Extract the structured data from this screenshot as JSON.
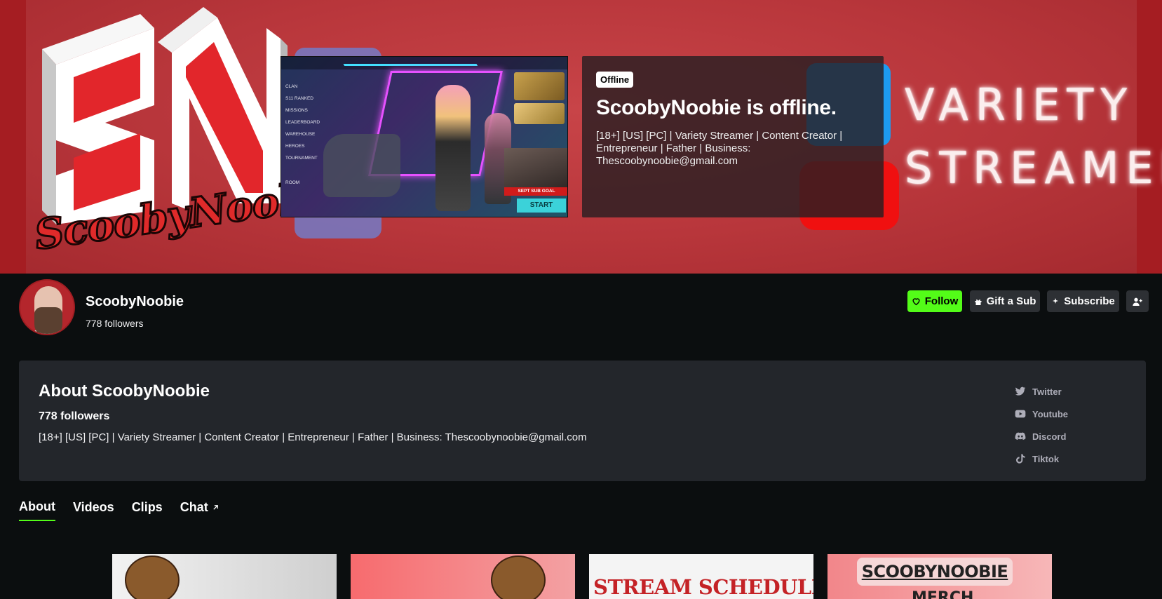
{
  "banner": {
    "logo_text": "ScoobyNoobie",
    "logo_initials": "SN",
    "tagline": "VARIETY STREAMER",
    "preview": {
      "menu": [
        "CLAN",
        "S11 RANKED",
        "MISSIONS",
        "LEADERBOARD",
        "WAREHOUSE",
        "HEROES",
        "TOURNAMENT",
        "ROOM"
      ],
      "goal": "SEPT SUB GOAL",
      "start": "START"
    }
  },
  "offline": {
    "badge": "Offline",
    "title": "ScoobyNoobie is offline.",
    "description": "[18+] [US] [PC] | Variety Streamer | Content Creator | Entrepreneur | Father | Business: Thescoobynoobie@gmail.com"
  },
  "channel": {
    "name": "ScoobyNoobie",
    "followers": "778 followers"
  },
  "actions": {
    "follow": "Follow",
    "gift": "Gift a Sub",
    "subscribe": "Subscribe"
  },
  "about": {
    "title": "About ScoobyNoobie",
    "followers": "778 followers",
    "description": "[18+] [US] [PC] | Variety Streamer | Content Creator | Entrepreneur | Father | Business: Thescoobynoobie@gmail.com",
    "socials": [
      {
        "label": "Twitter",
        "icon": "twitter-icon"
      },
      {
        "label": "Youtube",
        "icon": "youtube-icon"
      },
      {
        "label": "Discord",
        "icon": "discord-icon"
      },
      {
        "label": "Tiktok",
        "icon": "tiktok-icon"
      }
    ]
  },
  "tabs": [
    {
      "label": "About",
      "active": true
    },
    {
      "label": "Videos",
      "active": false
    },
    {
      "label": "Clips",
      "active": false
    },
    {
      "label": "Chat",
      "active": false
    }
  ],
  "panels": {
    "schedule": "STREAM SCHEDULE!",
    "merch_title": "SCOOBYNOOBIE",
    "merch_sub": "MERCH"
  },
  "colors": {
    "accent": "#53fc18",
    "background": "#0b0e0f",
    "card": "#23262b",
    "banner_red": "#b8363b"
  }
}
